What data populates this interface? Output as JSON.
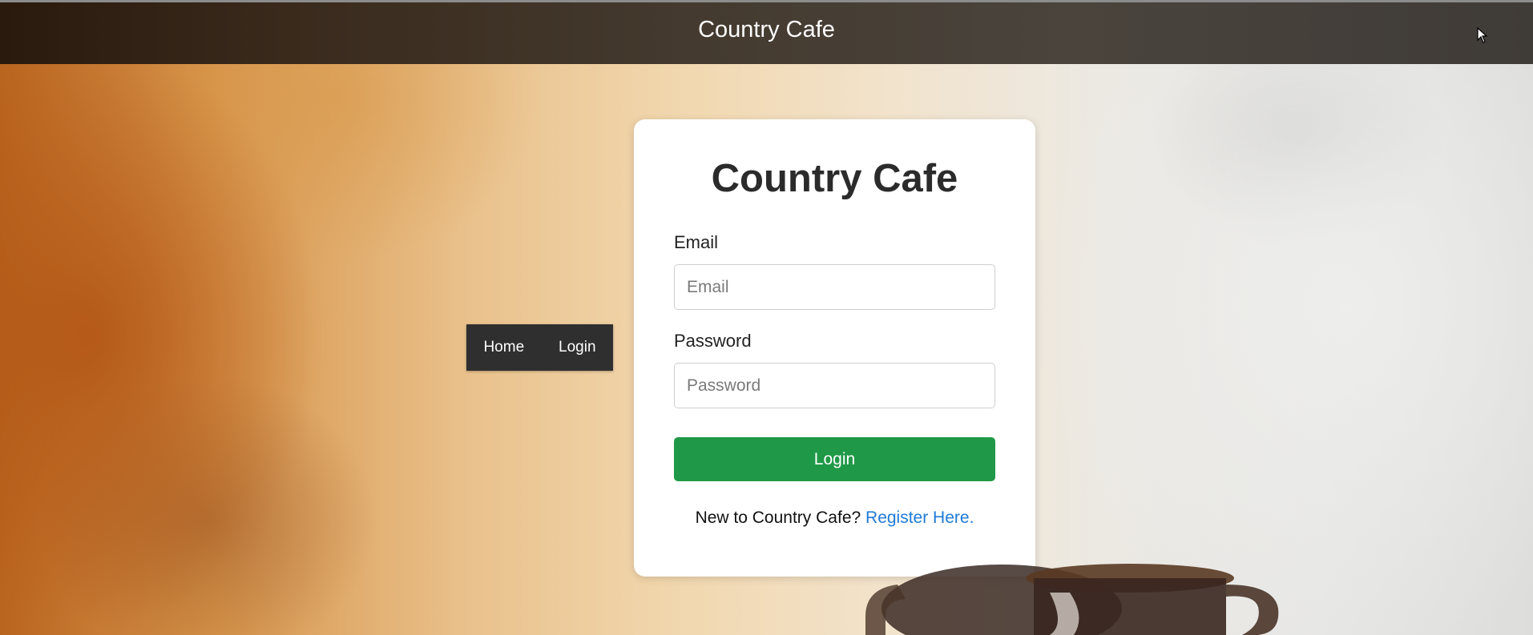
{
  "topbar": {
    "title": "Country Cafe"
  },
  "nav": {
    "items": [
      {
        "label": "Home"
      },
      {
        "label": "Login"
      }
    ]
  },
  "login_card": {
    "title": "Country Cafe",
    "email": {
      "label": "Email",
      "placeholder": "Email",
      "value": ""
    },
    "password": {
      "label": "Password",
      "placeholder": "Password",
      "value": ""
    },
    "submit_label": "Login",
    "register_prompt": "New to Country Cafe?",
    "register_link": "Register Here."
  },
  "colors": {
    "accent_green": "#1f9947",
    "link_blue": "#1f7ad6",
    "nav_background": "#2f2f2f"
  },
  "icons": {
    "cursor": "mouse-pointer-icon"
  }
}
